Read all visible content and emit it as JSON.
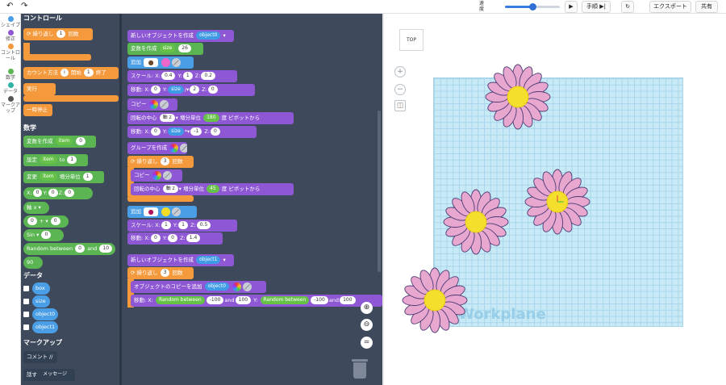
{
  "toolbar": {
    "speed_label": "速度",
    "speed_value": 0.5,
    "step_label": "手順",
    "export_label": "エクスポート",
    "share_label": "共有"
  },
  "categories": [
    {
      "label": "シェイプ",
      "color": "#4a9ee6"
    },
    {
      "label": "修正",
      "color": "#8e58d4"
    },
    {
      "label": "コントロール",
      "color": "#f59a3c"
    },
    {
      "label": "数学",
      "color": "#5ab552"
    },
    {
      "label": "データ",
      "color": "#2fb3a6"
    },
    {
      "label": "マークアップ",
      "color": "#555555"
    }
  ],
  "palette": {
    "control_title": "コントロール",
    "repeat": "繰り返し",
    "repeat_n": "1",
    "repeat_unit": "回数",
    "count": "カウント方法",
    "count_var": "i",
    "count_start": "開始",
    "count_start_v": "1",
    "count_end": "終了",
    "exec": "実行",
    "pause": "一時停止",
    "math_title": "数学",
    "create_var": "変数を作成",
    "create_var_name": "item",
    "create_var_v": "0",
    "set": "設定",
    "set_var": "item",
    "set_to": "to",
    "set_v": "1",
    "change": "変更",
    "change_var": "item",
    "change_by": "増分単位",
    "change_v": "1",
    "xyz_x": "X:",
    "xyz_x_v": "0",
    "xyz_y": "Y:",
    "xyz_y_v": "0",
    "xyz_z": "Z:",
    "xyz_z_v": "0",
    "axis": "軸 x",
    "arith_a": "0",
    "arith_op": "+",
    "arith_b": "0",
    "sin": "Sin",
    "sin_v": "0",
    "rand": "Random between",
    "rand_a": "0",
    "rand_and": "and",
    "rand_b": "10",
    "num": "90",
    "data_title": "データ",
    "vars": [
      "box",
      "size",
      "object0",
      "object1"
    ],
    "markup_title": "マークアップ",
    "comment": "コメント //",
    "say": "話す",
    "message": "メッセージ"
  },
  "workspace": {
    "new_obj": "新しいオブジェクトを作成",
    "obj0": "object0",
    "obj1": "object1",
    "create_var": "変数を作成",
    "size": "size",
    "size_v": "26",
    "add": "追加",
    "scale": "スケール:",
    "sx": "X:",
    "sx_v": "0.4",
    "sy": "Y:",
    "sy_v": "1",
    "sz": "Z:",
    "sz_v": "0.2",
    "move": "移動:",
    "x": "X:",
    "x_v": "0",
    "y": "Y:",
    "div_op": "/",
    "div_v": "2",
    "z": "Z:",
    "z_v": "0",
    "copy": "コピー",
    "rot": "回転の中心",
    "axis_z": "軸 z",
    "inc": "増分単位",
    "deg": "度",
    "pivot": "ピボットから",
    "rot_v": "180",
    "rot_v2": "45",
    "mul_op": "*",
    "mul_v": "-1",
    "group": "グループを作成",
    "repeat": "繰り返し",
    "rep_v": "3",
    "rep_unit": "回数",
    "scale2_x": "1",
    "scale2_y": "1",
    "scale2_z": "0.5",
    "move2_x": "0",
    "move2_y": "0",
    "move2_z": "1.4",
    "add_copy": "オブジェクトのコピーを追加",
    "rand": "Random between",
    "rand_a": "-100",
    "rand_and": "and",
    "rand_b": "100"
  },
  "viewer": {
    "top_label": "TOP",
    "plus": "+",
    "minus": "−",
    "workplane_label": "Workplane"
  }
}
